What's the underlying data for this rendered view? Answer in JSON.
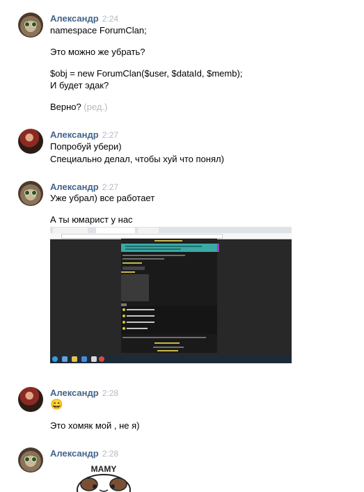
{
  "messages": [
    {
      "author": "Александр",
      "time": "2:24",
      "lines": [
        "namespace ForumClan;",
        "Это можно же убрать?",
        "$obj = new ForumClan($user, $dataId, $memb);",
        "И будет эдак?",
        "Верно?"
      ],
      "edited_label": "(ред.)"
    },
    {
      "author": "Александр",
      "time": "2:27",
      "lines": [
        "Попробуй убери)",
        "Специально делал, чтобы хуй что понял)"
      ]
    },
    {
      "author": "Александр",
      "time": "2:27",
      "lines": [
        "Уже убрал) все работает",
        "А ты юмарист у нас"
      ],
      "attachment": "browser-screenshot"
    },
    {
      "author": "Александр",
      "time": "2:28",
      "emoji": "😄",
      "lines": [
        "Это хомяк мой , не я)"
      ]
    },
    {
      "author": "Александр",
      "time": "2:28",
      "sticker_text": "MAMY"
    }
  ],
  "colors": {
    "author": "#42648b",
    "timestamp": "#b4b9c0",
    "text": "#000000",
    "background": "#ffffff"
  },
  "icons": [
    "avatar-cat",
    "avatar-person",
    "grin-emoji",
    "sticker"
  ]
}
